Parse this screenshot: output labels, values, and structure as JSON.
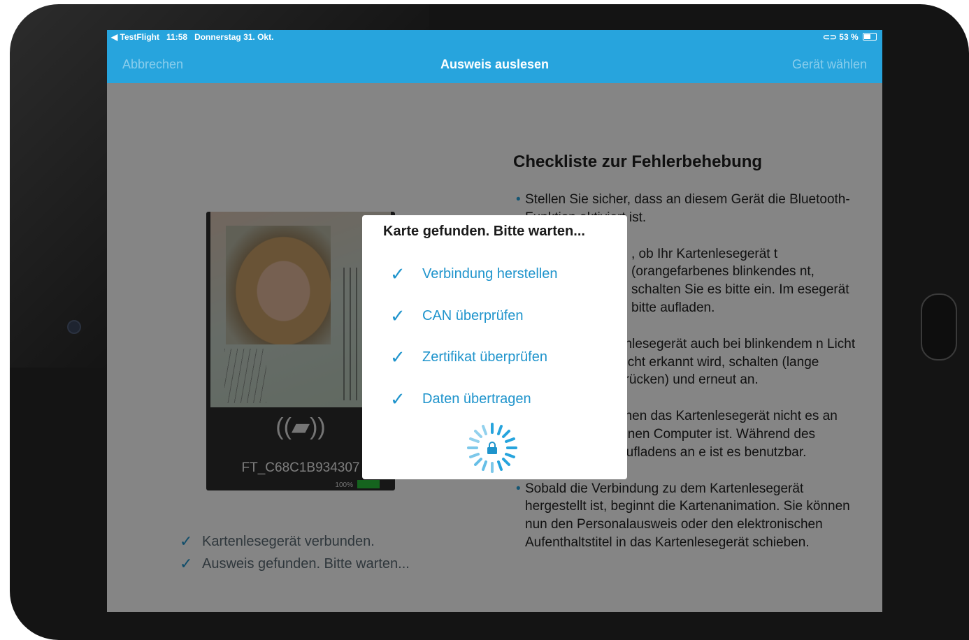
{
  "status_bar": {
    "back_app": "◀ TestFlight",
    "time": "11:58",
    "date": "Donnerstag 31. Okt.",
    "battery": "53 %"
  },
  "nav": {
    "left": "Abbrechen",
    "title": "Ausweis auslesen",
    "right": "Gerät wählen"
  },
  "reader": {
    "name": "FT_C68C1B934307",
    "battery": "100%",
    "icon": "nfc-card-icon"
  },
  "status_list": [
    "Kartenlesegerät verbunden.",
    "Ausweis gefunden. Bitte warten..."
  ],
  "checklist": {
    "title": "Checkliste zur Fehlerbehebung",
    "items": [
      "Stellen Sie sicher, dass an diesem Gerät die Bluetooth-Funktion aktiviert ist.",
      ", ob Ihr Kartenlesegerät t (orangefarbenes blinkendes nt, schalten Sie es bitte ein. Im esegerät bitte aufladen.",
      "enlesegerät auch bei blinkendem n Licht nicht erkannt wird, schalten (lange drücken) und erneut an.",
      "nnen das Kartenlesegerät nicht es an einen Computer ist. Während des Aufladens an e ist es benutzbar.",
      "Sobald die Verbindung zu dem Kartenlesegerät hergestellt ist, beginnt die Kartenanimation. Sie können nun den Personalausweis oder den elektronischen Aufenthaltstitel in das Kartenlesegerät schieben."
    ]
  },
  "modal": {
    "title": "Karte gefunden. Bitte warten...",
    "steps": [
      "Verbindung herstellen",
      "CAN überprüfen",
      "Zertifikat überprüfen",
      "Daten übertragen"
    ]
  },
  "colors": {
    "accent": "#27a4dd",
    "check": "#1f94cc"
  }
}
